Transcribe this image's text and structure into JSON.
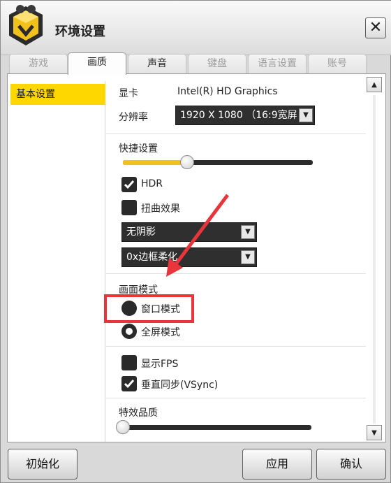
{
  "window": {
    "title": "环境设置",
    "close_symbol": "✕"
  },
  "tabs": [
    {
      "label": "游戏"
    },
    {
      "label": "画质"
    },
    {
      "label": "声音"
    },
    {
      "label": "键盘"
    },
    {
      "label": "语言设置"
    },
    {
      "label": "账号"
    }
  ],
  "sidebar": {
    "items": [
      {
        "label": "基本设置"
      }
    ]
  },
  "display": {
    "gpu_label": "显卡",
    "gpu_value": "Intel(R) HD Graphics",
    "resolution_label": "分辨率",
    "resolution_value": "1920 X 1080 （16:9宽屏"
  },
  "quick": {
    "label": "快捷设置",
    "slider_level": 0.34,
    "hdr_label": "HDR",
    "hdr_checked": true,
    "distortion_label": "扭曲效果",
    "distortion_checked": false,
    "shadow_value": "无阴影",
    "aa_value": "0x边框柔化"
  },
  "screen_mode": {
    "label": "画面模式",
    "window_label": "窗口模式",
    "fullscreen_label": "全屏模式",
    "selected": "fullscreen"
  },
  "misc": {
    "fps_label": "显示FPS",
    "fps_checked": false,
    "vsync_label": "垂直同步(VSync)",
    "vsync_checked": true
  },
  "effects": {
    "label": "特效品质",
    "slider_level": 0.0
  },
  "footer": {
    "reset_label": "初始化",
    "apply_label": "应用",
    "ok_label": "确认"
  },
  "colors": {
    "accent": "#f1c21b",
    "highlight_red": "#e8353b",
    "nav_selected": "#ffd700"
  }
}
